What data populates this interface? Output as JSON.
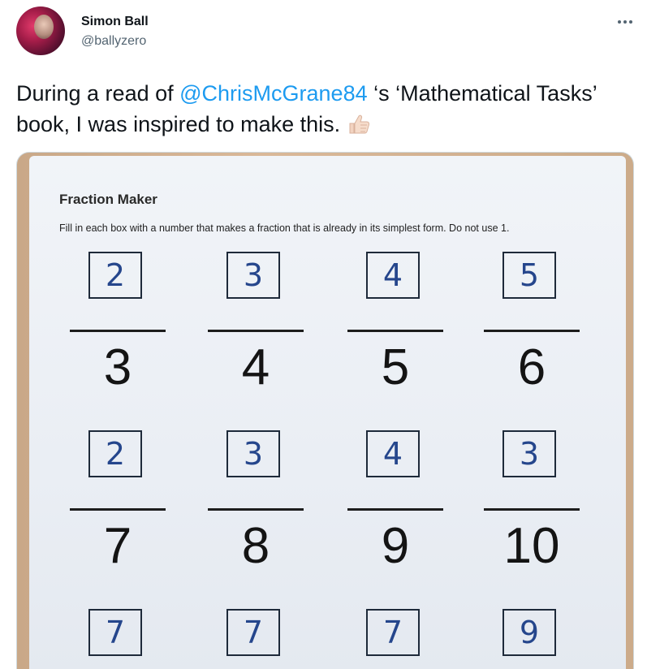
{
  "author": {
    "name": "Simon Ball",
    "handle": "@ballyzero"
  },
  "more_icon": "more-horizontal-icon",
  "tweet": {
    "text_before": "During a read of ",
    "mention": "@ChrisMcGrane84",
    "text_after": " ‘s ‘Mathematical Tasks’ book, I was inspired to make this.",
    "emoji": "thumbs-up-icon"
  },
  "photo": {
    "title": "Fraction Maker",
    "instructions": "Fill in each box with a number that makes a fraction that is already in its simplest form. Do not use 1.",
    "fractions": [
      {
        "numerator": "2",
        "denominator": "3"
      },
      {
        "numerator": "3",
        "denominator": "4"
      },
      {
        "numerator": "4",
        "denominator": "5"
      },
      {
        "numerator": "5",
        "denominator": "6"
      },
      {
        "numerator": "2",
        "denominator": "7"
      },
      {
        "numerator": "3",
        "denominator": "8"
      },
      {
        "numerator": "4",
        "denominator": "9"
      },
      {
        "numerator": "3",
        "denominator": "10"
      },
      {
        "numerator": "7",
        "denominator": ""
      },
      {
        "numerator": "7",
        "denominator": ""
      },
      {
        "numerator": "7",
        "denominator": ""
      },
      {
        "numerator": "9",
        "denominator": ""
      }
    ]
  },
  "colors": {
    "mention": "#1d9bf0",
    "handle": "#536471",
    "ink": "#25468c"
  }
}
